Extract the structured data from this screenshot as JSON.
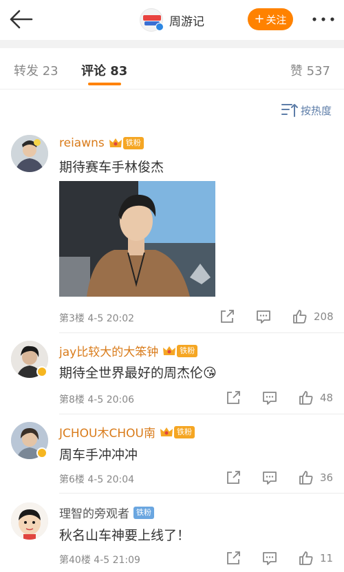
{
  "header": {
    "account_name": "周游记",
    "follow_label": "关注",
    "back_icon": "back-arrow-icon",
    "more_icon": "more-dots-icon"
  },
  "tabs": {
    "repost": "转发 23",
    "comment": "评论 83",
    "like": "赞 537"
  },
  "sort": {
    "label": "按热度"
  },
  "colors": {
    "accent": "#ff8200",
    "username": "#d97b1a",
    "link": "#5d7da8"
  },
  "comments": [
    {
      "user": "reiawns",
      "badge": "铁粉",
      "text": "期待赛车手林俊杰",
      "floor": "第3楼",
      "time": "4-5 20:02",
      "likes": "208"
    },
    {
      "user": "jay比较大的大笨钟",
      "badge": "铁粉",
      "text": "期待全世界最好的周杰伦😘",
      "floor": "第8楼",
      "time": "4-5 20:06",
      "likes": "48"
    },
    {
      "user": "JCHOU木CHOU南",
      "badge": "铁粉",
      "text": "周车手冲冲冲",
      "floor": "第6楼",
      "time": "4-5 20:04",
      "likes": "36"
    },
    {
      "user": "理智的旁观者",
      "badge": "铁粉",
      "text": "秋名山车神要上线了！",
      "floor": "第40楼",
      "time": "4-5 21:09",
      "likes": "11"
    }
  ]
}
